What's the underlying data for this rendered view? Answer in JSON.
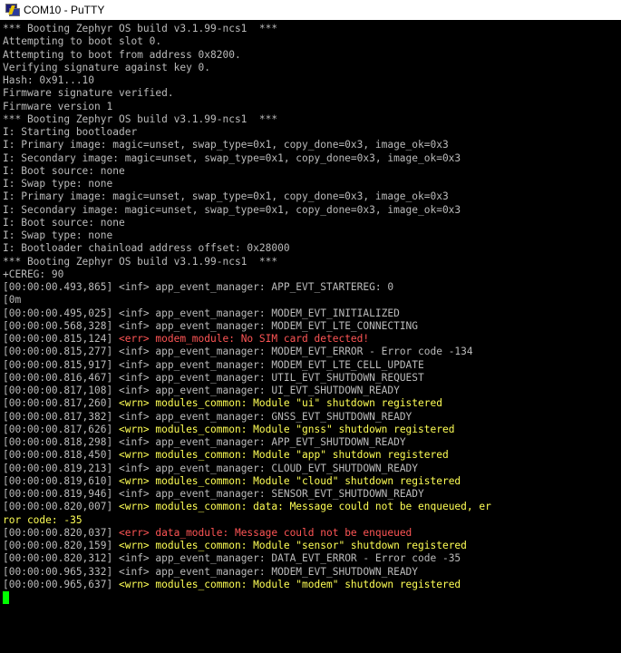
{
  "window": {
    "title": "COM10 - PuTTY",
    "icon": "putty-icon"
  },
  "colors": {
    "background": "#000000",
    "text": "#bbbbbb",
    "warning": "#ffff55",
    "error": "#ff5555",
    "cursor": "#00ff00"
  },
  "terminal": {
    "lines": [
      {
        "kind": "plain",
        "text": "*** Booting Zephyr OS build v3.1.99-ncs1  ***"
      },
      {
        "kind": "plain",
        "text": "Attempting to boot slot 0."
      },
      {
        "kind": "plain",
        "text": "Attempting to boot from address 0x8200."
      },
      {
        "kind": "plain",
        "text": "Verifying signature against key 0."
      },
      {
        "kind": "plain",
        "text": "Hash: 0x91...10"
      },
      {
        "kind": "plain",
        "text": "Firmware signature verified."
      },
      {
        "kind": "plain",
        "text": "Firmware version 1"
      },
      {
        "kind": "plain",
        "text": "*** Booting Zephyr OS build v3.1.99-ncs1  ***"
      },
      {
        "kind": "plain",
        "text": "I: Starting bootloader"
      },
      {
        "kind": "plain",
        "text": "I: Primary image: magic=unset, swap_type=0x1, copy_done=0x3, image_ok=0x3"
      },
      {
        "kind": "plain",
        "text": "I: Secondary image: magic=unset, swap_type=0x1, copy_done=0x3, image_ok=0x3"
      },
      {
        "kind": "plain",
        "text": "I: Boot source: none"
      },
      {
        "kind": "plain",
        "text": "I: Swap type: none"
      },
      {
        "kind": "plain",
        "text": "I: Primary image: magic=unset, swap_type=0x1, copy_done=0x3, image_ok=0x3"
      },
      {
        "kind": "plain",
        "text": "I: Secondary image: magic=unset, swap_type=0x1, copy_done=0x3, image_ok=0x3"
      },
      {
        "kind": "plain",
        "text": "I: Boot source: none"
      },
      {
        "kind": "plain",
        "text": "I: Swap type: none"
      },
      {
        "kind": "plain",
        "text": "I: Bootloader chainload address offset: 0x28000"
      },
      {
        "kind": "plain",
        "text": "*** Booting Zephyr OS build v3.1.99-ncs1  ***"
      },
      {
        "kind": "plain",
        "text": "+CEREG: 90"
      },
      {
        "kind": "inf",
        "ts": "[00:00:00.493,865] ",
        "text": "<inf> app_event_manager: APP_EVT_STARTEREG: 0"
      },
      {
        "kind": "plain",
        "text": "[0m"
      },
      {
        "kind": "inf",
        "ts": "[00:00:00.495,025] ",
        "text": "<inf> app_event_manager: MODEM_EVT_INITIALIZED"
      },
      {
        "kind": "inf",
        "ts": "[00:00:00.568,328] ",
        "text": "<inf> app_event_manager: MODEM_EVT_LTE_CONNECTING"
      },
      {
        "kind": "err",
        "ts": "[00:00:00.815,124] ",
        "text": "<err> modem_module: No SIM card detected!"
      },
      {
        "kind": "inf",
        "ts": "[00:00:00.815,277] ",
        "text": "<inf> app_event_manager: MODEM_EVT_ERROR - Error code -134"
      },
      {
        "kind": "inf",
        "ts": "[00:00:00.815,917] ",
        "text": "<inf> app_event_manager: MODEM_EVT_LTE_CELL_UPDATE"
      },
      {
        "kind": "inf",
        "ts": "[00:00:00.816,467] ",
        "text": "<inf> app_event_manager: UTIL_EVT_SHUTDOWN_REQUEST"
      },
      {
        "kind": "inf",
        "ts": "[00:00:00.817,108] ",
        "text": "<inf> app_event_manager: UI_EVT_SHUTDOWN_READY"
      },
      {
        "kind": "wrn",
        "ts": "[00:00:00.817,260] ",
        "text": "<wrn> modules_common: Module \"ui\" shutdown registered"
      },
      {
        "kind": "inf",
        "ts": "[00:00:00.817,382] ",
        "text": "<inf> app_event_manager: GNSS_EVT_SHUTDOWN_READY"
      },
      {
        "kind": "wrn",
        "ts": "[00:00:00.817,626] ",
        "text": "<wrn> modules_common: Module \"gnss\" shutdown registered"
      },
      {
        "kind": "inf",
        "ts": "[00:00:00.818,298] ",
        "text": "<inf> app_event_manager: APP_EVT_SHUTDOWN_READY"
      },
      {
        "kind": "wrn",
        "ts": "[00:00:00.818,450] ",
        "text": "<wrn> modules_common: Module \"app\" shutdown registered"
      },
      {
        "kind": "inf",
        "ts": "[00:00:00.819,213] ",
        "text": "<inf> app_event_manager: CLOUD_EVT_SHUTDOWN_READY"
      },
      {
        "kind": "wrn",
        "ts": "[00:00:00.819,610] ",
        "text": "<wrn> modules_common: Module \"cloud\" shutdown registered"
      },
      {
        "kind": "inf",
        "ts": "[00:00:00.819,946] ",
        "text": "<inf> app_event_manager: SENSOR_EVT_SHUTDOWN_READY"
      },
      {
        "kind": "wrn",
        "ts": "[00:00:00.820,007] ",
        "text": "<wrn> modules_common: data: Message could not be enqueued, er"
      },
      {
        "kind": "wrn",
        "text": "ror code: -35"
      },
      {
        "kind": "err",
        "ts": "[00:00:00.820,037] ",
        "text": "<err> data_module: Message could not be enqueued"
      },
      {
        "kind": "wrn",
        "ts": "[00:00:00.820,159] ",
        "text": "<wrn> modules_common: Module \"sensor\" shutdown registered"
      },
      {
        "kind": "inf",
        "ts": "[00:00:00.820,312] ",
        "text": "<inf> app_event_manager: DATA_EVT_ERROR - Error code -35"
      },
      {
        "kind": "inf",
        "ts": "[00:00:00.965,332] ",
        "text": "<inf> app_event_manager: MODEM_EVT_SHUTDOWN_READY"
      },
      {
        "kind": "wrn",
        "ts": "[00:00:00.965,637] ",
        "text": "<wrn> modules_common: Module \"modem\" shutdown registered"
      }
    ]
  }
}
